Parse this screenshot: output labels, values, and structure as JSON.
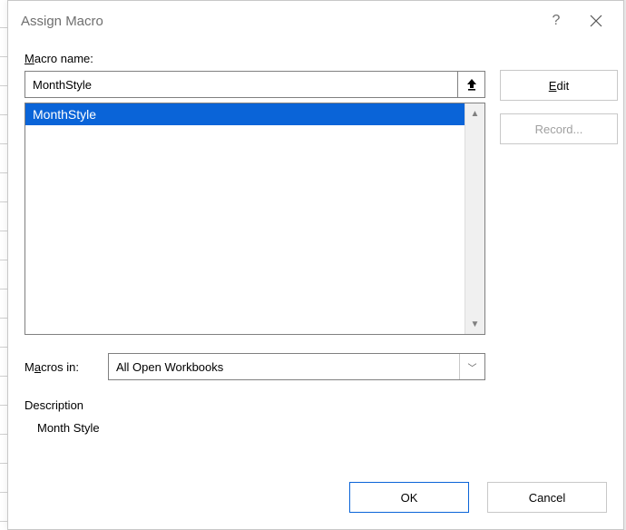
{
  "dialog": {
    "title": "Assign Macro",
    "labels": {
      "macro_name": "Macro name:",
      "macros_in": "Macros in:",
      "description": "Description"
    },
    "macro_name_value": "MonthStyle",
    "list_items": [
      "MonthStyle"
    ],
    "macros_in_value": "All Open Workbooks",
    "description_text": "Month Style",
    "buttons": {
      "edit": "Edit",
      "record": "Record...",
      "ok": "OK",
      "cancel": "Cancel"
    }
  }
}
